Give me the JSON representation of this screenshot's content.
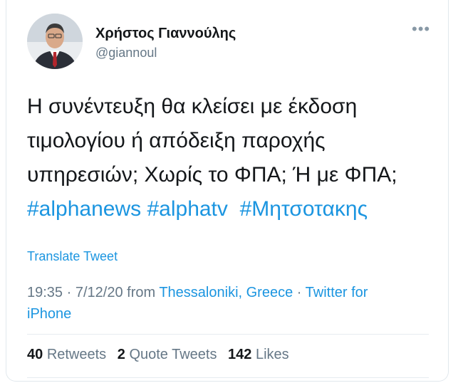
{
  "author": {
    "name": "Χρήστος Γιαννούλης",
    "handle": "@giannoul"
  },
  "tweet": {
    "line1": "Η συνέντευξη θα κλείσει με έκδοση",
    "line2": "τιμολογίου ή απόδειξη παροχής",
    "line3": "υπηρεσιών; Χωρίς το ΦΠΑ; Ή με ΦΠΑ;",
    "hashtags": [
      "#alphanews",
      "#alphatv",
      "#Μητσοτακης"
    ]
  },
  "translate_label": "Translate Tweet",
  "meta": {
    "time": "19:35",
    "date": "7/12/20",
    "from": "from",
    "location": "Thessaloniki, Greece",
    "source_prefix": "Twitter for",
    "source_suffix": "iPhone"
  },
  "stats": {
    "retweets_count": "40",
    "retweets_label": "Retweets",
    "quotes_count": "2",
    "quotes_label": "Quote Tweets",
    "likes_count": "142",
    "likes_label": "Likes"
  },
  "icons": {
    "more": "more-options-icon",
    "avatar": "profile-photo"
  },
  "colors": {
    "link": "#1b95e0",
    "secondary": "#657786",
    "text": "#14171a"
  }
}
